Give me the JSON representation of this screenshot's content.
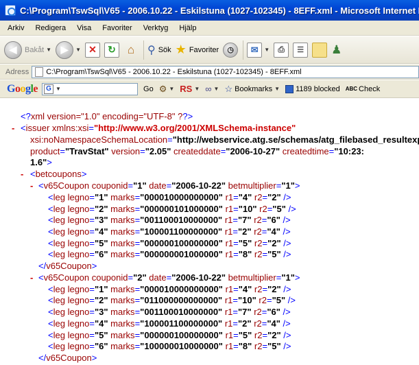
{
  "window": {
    "title": "C:\\Program\\TswSql\\V65 - 2006.10.22 - Eskilstuna (1027-102345) - 8EFF.xml - Microsoft Internet Explorer"
  },
  "menu": [
    "Arkiv",
    "Redigera",
    "Visa",
    "Favoriter",
    "Verktyg",
    "Hjälp"
  ],
  "toolbar": {
    "back_label": "Bakåt",
    "search_label": "Sök",
    "favorites_label": "Favoriter"
  },
  "address": {
    "label": "Adress",
    "value": "C:\\Program\\TswSql\\V65 - 2006.10.22 - Eskilstuna (1027-102345) - 8EFF.xml"
  },
  "google_toolbar": {
    "logo": [
      "G",
      "o",
      "o",
      "g",
      "l",
      "e"
    ],
    "search_badge": "G",
    "go_label": "Go",
    "rs_label": "RS",
    "bookmarks_label": "Bookmarks",
    "blocked_label": "1189 blocked",
    "check_label": "Check",
    "check_icon_text": "ABC"
  },
  "xml": {
    "decl": {
      "text": "xml version=\"1.0\" encoding=\"UTF-8\" ?"
    },
    "issuer": {
      "toggle": "-",
      "tag": "issuer",
      "xsi_attr": "xmlns:xsi",
      "xsi_val": "\"http://www.w3.org/2001/XMLSchema-instance\"",
      "nsl_attr": "xsi:noNamespaceSchemaLocation",
      "nsl_val": "\"http://webservice.atg.se/schemas/atg_filebased_resultexport.xsd\"",
      "product_attr": "product",
      "product_val": "\"TravStat\"",
      "version_attr": "version",
      "version_val": "\"2.05\"",
      "createddate_attr": "createddate",
      "createddate_val": "\"2006-10-27\"",
      "createdtime_attr": "createdtime",
      "createdtime_val": "\"10:23:",
      "wrap_val": "1.6\""
    },
    "betcoupons": {
      "toggle": "-",
      "tag": "betcoupons"
    },
    "coupons": [
      {
        "toggle": "-",
        "tag": "v65Coupon",
        "couponid": "\"1\"",
        "date": "\"2006-10-22\"",
        "betmultiplier": "\"1\"",
        "close_tag": "v65Coupon",
        "legs": [
          {
            "legno": "\"1\"",
            "marks": "\"000010000000000\"",
            "r1": "\"4\"",
            "r2": "\"2\""
          },
          {
            "legno": "\"2\"",
            "marks": "\"000000101000000\"",
            "r1": "\"10\"",
            "r2": "\"5\""
          },
          {
            "legno": "\"3\"",
            "marks": "\"001100010000000\"",
            "r1": "\"7\"",
            "r2": "\"6\""
          },
          {
            "legno": "\"4\"",
            "marks": "\"100001100000000\"",
            "r1": "\"2\"",
            "r2": "\"4\""
          },
          {
            "legno": "\"5\"",
            "marks": "\"000000100000000\"",
            "r1": "\"5\"",
            "r2": "\"2\""
          },
          {
            "legno": "\"6\"",
            "marks": "\"000000001000000\"",
            "r1": "\"8\"",
            "r2": "\"5\""
          }
        ]
      },
      {
        "toggle": "-",
        "tag": "v65Coupon",
        "couponid": "\"2\"",
        "date": "\"2006-10-22\"",
        "betmultiplier": "\"1\"",
        "close_tag": "v65Coupon",
        "legs": [
          {
            "legno": "\"1\"",
            "marks": "\"000010000000000\"",
            "r1": "\"4\"",
            "r2": "\"2\""
          },
          {
            "legno": "\"2\"",
            "marks": "\"011000000000000\"",
            "r1": "\"10\"",
            "r2": "\"5\""
          },
          {
            "legno": "\"3\"",
            "marks": "\"001100010000000\"",
            "r1": "\"7\"",
            "r2": "\"6\""
          },
          {
            "legno": "\"4\"",
            "marks": "\"100001100000000\"",
            "r1": "\"2\"",
            "r2": "\"4\""
          },
          {
            "legno": "\"5\"",
            "marks": "\"000000100000000\"",
            "r1": "\"5\"",
            "r2": "\"2\""
          },
          {
            "legno": "\"6\"",
            "marks": "\"100000010000000\"",
            "r1": "\"8\"",
            "r2": "\"5\""
          }
        ]
      }
    ]
  }
}
